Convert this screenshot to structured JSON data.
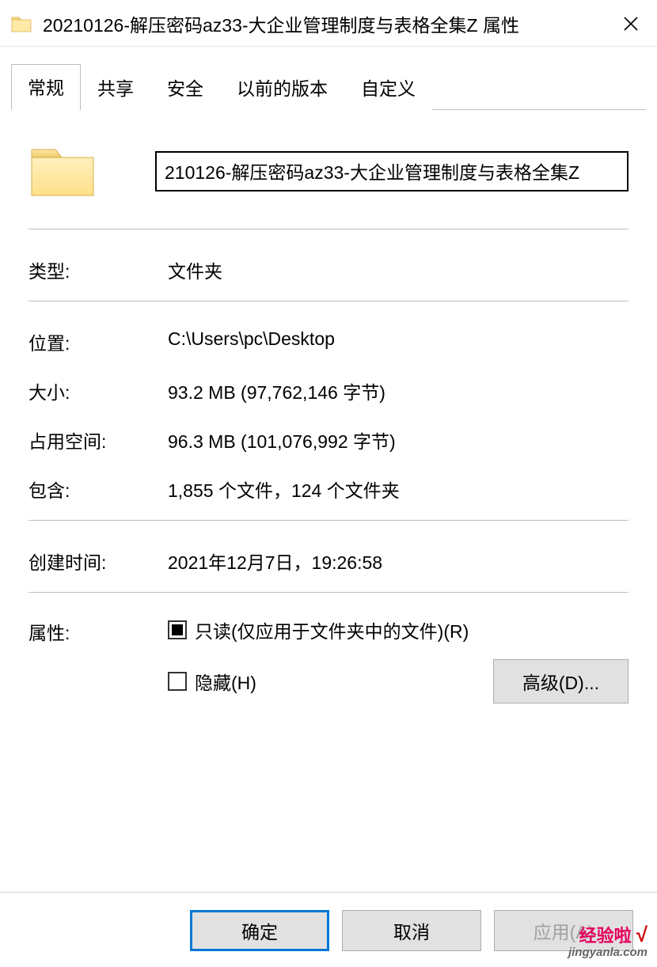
{
  "window": {
    "title": "20210126-解压密码az33-大企业管理制度与表格全集Z 属性"
  },
  "tabs": [
    {
      "label": "常规",
      "active": true
    },
    {
      "label": "共享",
      "active": false
    },
    {
      "label": "安全",
      "active": false
    },
    {
      "label": "以前的版本",
      "active": false
    },
    {
      "label": "自定义",
      "active": false
    }
  ],
  "general": {
    "name_value": "210126-解压密码az33-大企业管理制度与表格全集Z",
    "type_label": "类型:",
    "type_value": "文件夹",
    "location_label": "位置:",
    "location_value": "C:\\Users\\pc\\Desktop",
    "size_label": "大小:",
    "size_value": "93.2 MB (97,762,146 字节)",
    "size_on_disk_label": "占用空间:",
    "size_on_disk_value": "96.3 MB (101,076,992 字节)",
    "contains_label": "包含:",
    "contains_value": "1,855 个文件，124 个文件夹",
    "created_label": "创建时间:",
    "created_value": "2021年12月7日，19:26:58",
    "attributes_label": "属性:",
    "readonly_label": "只读(仅应用于文件夹中的文件)(R)",
    "hidden_label": "隐藏(H)",
    "advanced_label": "高级(D)..."
  },
  "footer": {
    "ok": "确定",
    "cancel": "取消",
    "apply": "应用(A)"
  },
  "watermark": {
    "line1": "经验啦",
    "check": "√",
    "line2": "jingyanla.com"
  }
}
